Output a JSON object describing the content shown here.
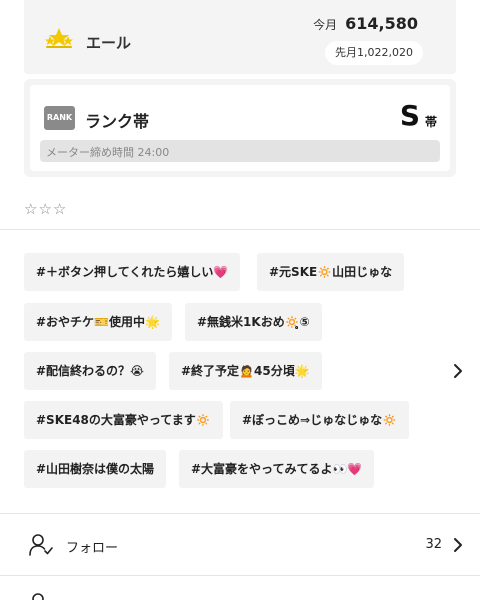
{
  "yell": {
    "label": "エール",
    "month_label": "今月",
    "month_value": "614,580",
    "last_month": "先月1,022,020",
    "icon": "star-cluster-icon",
    "icon_color": "#f5c800"
  },
  "rank": {
    "badge": "RANK",
    "label": "ランク帯",
    "letter": "S",
    "suffix": "帯",
    "meter": "メーター締め時間 24:00"
  },
  "rating": "☆☆☆",
  "tags": [
    "#＋ボタン押してくれたら嬉しい💗",
    "#元SKE🔅山田じゅな",
    "#おやチケ🎫使用中🌟",
    "#無銭米1Kおめ🔅̥̥̥⑤",
    "#配信終わるの？😭",
    "#終了予定🙍45分頃🌟",
    "#SKE48の大富豪やってます🔅",
    "#ぼっこめ⇒じゅなじゅな🔅",
    "#山田樹奈は僕の太陽",
    "#大富豪をやってみてるよ👀💗"
  ],
  "follow": {
    "label": "フォロー",
    "count": "32",
    "icon": "user-follow-icon"
  }
}
